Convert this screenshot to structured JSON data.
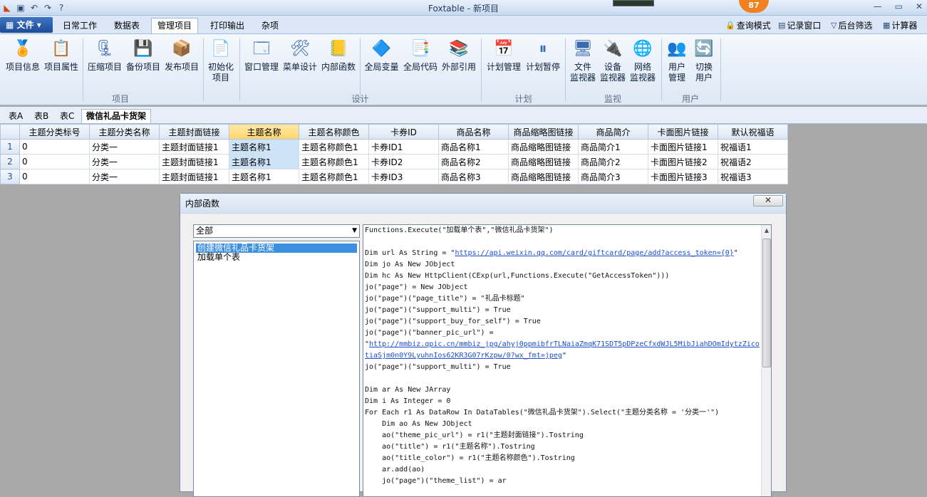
{
  "window": {
    "title": "Foxtable - 新项目",
    "badge": "87"
  },
  "menu": {
    "file": "文件",
    "tabs": [
      "日常工作",
      "数据表",
      "管理项目",
      "打印输出",
      "杂项"
    ],
    "active_tab": "管理项目",
    "right_items": [
      "查询模式",
      "记录窗口",
      "后台筛选",
      "计算器"
    ]
  },
  "ribbon": {
    "groups": [
      {
        "label": "项目",
        "buttons": [
          "项目信息",
          "项目属性",
          "压缩项目",
          "备份项目",
          "发布项目",
          "初始化\n项目"
        ]
      },
      {
        "label": "设计",
        "buttons": [
          "窗口管理",
          "菜单设计",
          "内部函数",
          "全局变量",
          "全局代码",
          "外部引用"
        ]
      },
      {
        "label": "计划",
        "buttons": [
          "计划管理",
          "计划暂停"
        ]
      },
      {
        "label": "监视",
        "buttons": [
          "文件\n监视器",
          "设备\n监视器",
          "网络\n监视器"
        ]
      },
      {
        "label": "用户",
        "buttons": [
          "用户\n管理",
          "切换\n用户"
        ]
      }
    ]
  },
  "sheets": {
    "tabs": [
      "表A",
      "表B",
      "表C",
      "微信礼品卡货架"
    ],
    "active": "微信礼品卡货架"
  },
  "grid": {
    "columns": [
      "主题分类标号",
      "主题分类名称",
      "主题封面链接",
      "主题名称",
      "主题名称颜色",
      "卡券ID",
      "商品名称",
      "商品缩略图链接",
      "商品简介",
      "卡面图片链接",
      "默认祝福语"
    ],
    "selected_column": "主题名称",
    "rows": [
      {
        "num": "1",
        "cells": [
          "0",
          "分类一",
          "主题封面链接1",
          "主题名称1",
          "主题名称颜色1",
          "卡券ID1",
          "商品名称1",
          "商品缩略图链接",
          "商品简介1",
          "卡面图片链接1",
          "祝福语1"
        ]
      },
      {
        "num": "2",
        "cells": [
          "0",
          "分类一",
          "主题封面链接1",
          "主题名称1",
          "主题名称颜色1",
          "卡券ID2",
          "商品名称2",
          "商品缩略图链接",
          "商品简介2",
          "卡面图片链接2",
          "祝福语2"
        ]
      },
      {
        "num": "3",
        "cells": [
          "0",
          "分类一",
          "主题封面链接1",
          "主题名称1",
          "主题名称颜色1",
          "卡券ID3",
          "商品名称3",
          "商品缩略图链接",
          "商品简介3",
          "卡面图片链接3",
          "祝福语3"
        ]
      }
    ]
  },
  "dialog": {
    "title": "内部函数",
    "close": "✕",
    "filter": "全部",
    "functions": [
      "创建微信礼品卡货架",
      "加载单个表"
    ],
    "selected_function": "创建微信礼品卡货架",
    "code": [
      "Functions.Execute(\"加载单个表\",\"微信礼品卡货架\")",
      "",
      "Dim url As String = \"https://api.weixin.qq.com/card/giftcard/page/add?access_token={0}\"",
      "Dim jo As New JObject",
      "Dim hc As New HttpClient(CExp(url,Functions.Execute(\"GetAccessToken\")))",
      "jo(\"page\") = New JObject",
      "jo(\"page\")(\"page_title\") = \"礼品卡标题\"",
      "jo(\"page\")(\"support_multi\") = True",
      "jo(\"page\")(\"support_buy_for_self\") = True",
      "jo(\"page\")(\"banner_pic_url\") =",
      "\"http://mmbiz.qpic.cn/mmbiz_jpg/ahyj0ppmibfrTLNaiaZmqK71SDT5pDPzeCfxdWJL5MibJiahDOmIdytzZico",
      "tiaSjm0n0Y9LyuhnIos62KR3G07rKzpw/0?wx_fmt=jpeg\"",
      "jo(\"page\")(\"support_multi\") = True",
      "",
      "Dim ar As New JArray",
      "Dim i As Integer = 0",
      "For Each r1 As DataRow In DataTables(\"微信礼品卡货架\").Select(\"主题分类名称 = '分类一'\")",
      "    Dim ao As New JObject",
      "    ao(\"theme_pic_url\") = r1(\"主题封面链接\").Tostring",
      "    ao(\"title\") = r1(\"主题名称\").Tostring",
      "    ao(\"title_color\") = r1(\"主题名称颜色\").Tostring",
      "    ar.add(ao)",
      "    jo(\"page\")(\"theme_list\") = ar"
    ]
  }
}
